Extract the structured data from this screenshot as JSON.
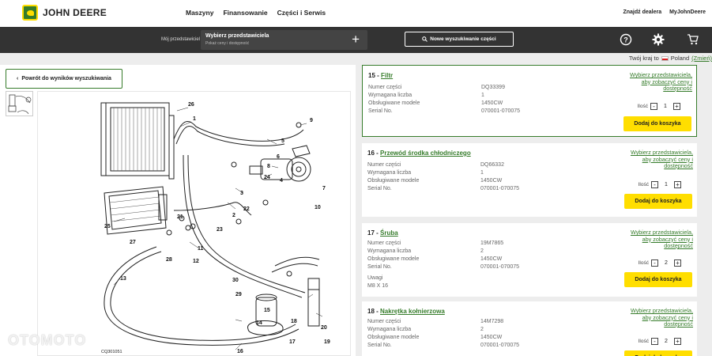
{
  "header": {
    "brand": "JOHN DEERE",
    "nav": [
      "Maszyny",
      "Finansowanie",
      "Części i Serwis"
    ],
    "right_links": [
      "Znajdź dealera",
      "MyJohnDeere"
    ]
  },
  "dealer_bar": {
    "label": "Mój przedstawiciel",
    "title": "Wybierz przedstawiciela",
    "subtitle": "Pokaż ceny i dostępność",
    "add": "+",
    "new_search": "Nowe wyszukiwanie części"
  },
  "country": {
    "prefix": "Twój kraj to",
    "name": "Poland",
    "change": "(Zmień)"
  },
  "back_button": "Powrót do wyników wyszukiwania",
  "diagram": {
    "caption": "CQ301051",
    "callouts": [
      "26",
      "1",
      "9",
      "5",
      "8",
      "6",
      "24",
      "3",
      "4",
      "7",
      "10",
      "22",
      "23",
      "2",
      "21",
      "25",
      "27",
      "11",
      "12",
      "28",
      "30",
      "29",
      "13",
      "17",
      "18",
      "20",
      "14",
      "15",
      "19",
      "16"
    ]
  },
  "watermark": "OTOMOTO",
  "labels": {
    "part_number": "Numer części",
    "required_qty": "Wymagana liczba",
    "models": "Obsługiwane modele",
    "serial": "Serial No.",
    "notes": "Uwagi",
    "dealer_cta": "Wybierz przedstawiciela, aby zobaczyć ceny i dostępność",
    "qty": "Ilość",
    "add_to_cart": "Dodaj do koszyka"
  },
  "parts": [
    {
      "num": "15",
      "name": "Filtr",
      "part_number": "DQ33399",
      "required": "1",
      "model": "1450CW",
      "serial": "070001-070075",
      "qty": "1",
      "note": ""
    },
    {
      "num": "16",
      "name": "Przewód środka chłodniczego",
      "part_number": "DQ66332",
      "required": "1",
      "model": "1450CW",
      "serial": "070001-070075",
      "qty": "1",
      "note": ""
    },
    {
      "num": "17",
      "name": "Śruba",
      "part_number": "19M7865",
      "required": "2",
      "model": "1450CW",
      "serial": "070001-070075",
      "qty": "2",
      "note": "M8 X 16"
    },
    {
      "num": "18",
      "name": "Nakrętka kołnierzowa",
      "part_number": "14M7298",
      "required": "2",
      "model": "1450CW",
      "serial": "070001-070075",
      "qty": "2",
      "note": ""
    }
  ]
}
